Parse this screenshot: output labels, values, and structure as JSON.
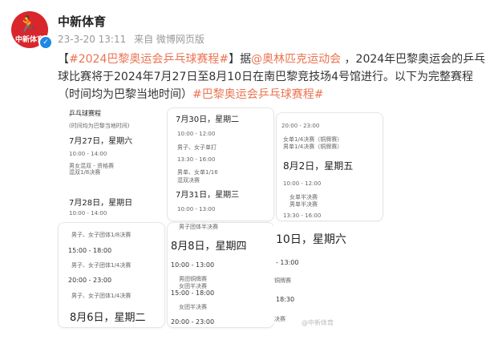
{
  "account": {
    "name": "中新体育",
    "avatar_label": "中新体育",
    "verified_mark": "✓"
  },
  "meta": {
    "time": "23-3-20 13:11",
    "source": "来自 微博网页版"
  },
  "post": {
    "bracket_open": "【",
    "topic": "#2024巴黎奥运会乒乓球赛程#",
    "bracket_close": "】",
    "pre_mention": "据",
    "mention": "@奥林匹克运动会",
    "text": " ，2024年巴黎奥运会的乒乓球比赛将于2024年7月27日至8月10日在南巴黎竞技场4号馆进行。以下为完整赛程（时间均为巴黎当地时间）",
    "topic2": "#巴黎奥运会乒乓球赛程#"
  },
  "images": {
    "img1": {
      "header": "乒乓球赛程",
      "sub": "(时间均为巴黎当地时间)",
      "date1": "7月27日，星期六",
      "t1": "10:00 - 14:00",
      "i1": "男女混双 - 资格赛",
      "i2": "混双1/8决赛",
      "date2": "7月28日，星期日",
      "t2": "10:00 - 14:00"
    },
    "img2": {
      "date1": "7月30日，星期二",
      "t1": "10:00 - 12:00",
      "i1": "男子、女子单打",
      "t2": "13:30 - 16:00",
      "i2": "男单、女单1/16",
      "i3": "混双决赛",
      "date2": "7月31日，星期三",
      "t3": "10:00 - 13:00"
    },
    "img3": {
      "t1": "20:00 - 23:00",
      "i1": "女单1/4决赛（铜牌赛）",
      "i2": "男单1/4决赛（铜牌赛）",
      "date": "8月2日，星期五",
      "t2": "10:00 - 12:00",
      "i3": "女单半决赛",
      "i4": "男单半决赛",
      "t3": "13:30 - 16:00"
    },
    "img4": {
      "i1": "男子、女子团体1/8决赛",
      "t1": "15:00 - 18:00",
      "i2": "男子、女子团体1/4决赛",
      "t2": "20:00 - 23:00",
      "i3": "男子、女子团体1/4决赛",
      "date": "8月6日，星期二"
    },
    "img5": {
      "i0": "男子团体半决赛",
      "date": "8月8日，星期四",
      "t1": "10:00 - 13:00",
      "i1": "男团铜牌赛",
      "i2": "女团半决赛",
      "t2": "15:00 - 18:00",
      "i3": "女团半决赛",
      "t3": "20:00 - 23:00"
    },
    "img6": {
      "date": "10日，星期六",
      "t1": "- 13:00",
      "i1": "铜牌赛",
      "t2": "18:30",
      "i2": "决赛"
    }
  },
  "watermark": "@中新体育"
}
